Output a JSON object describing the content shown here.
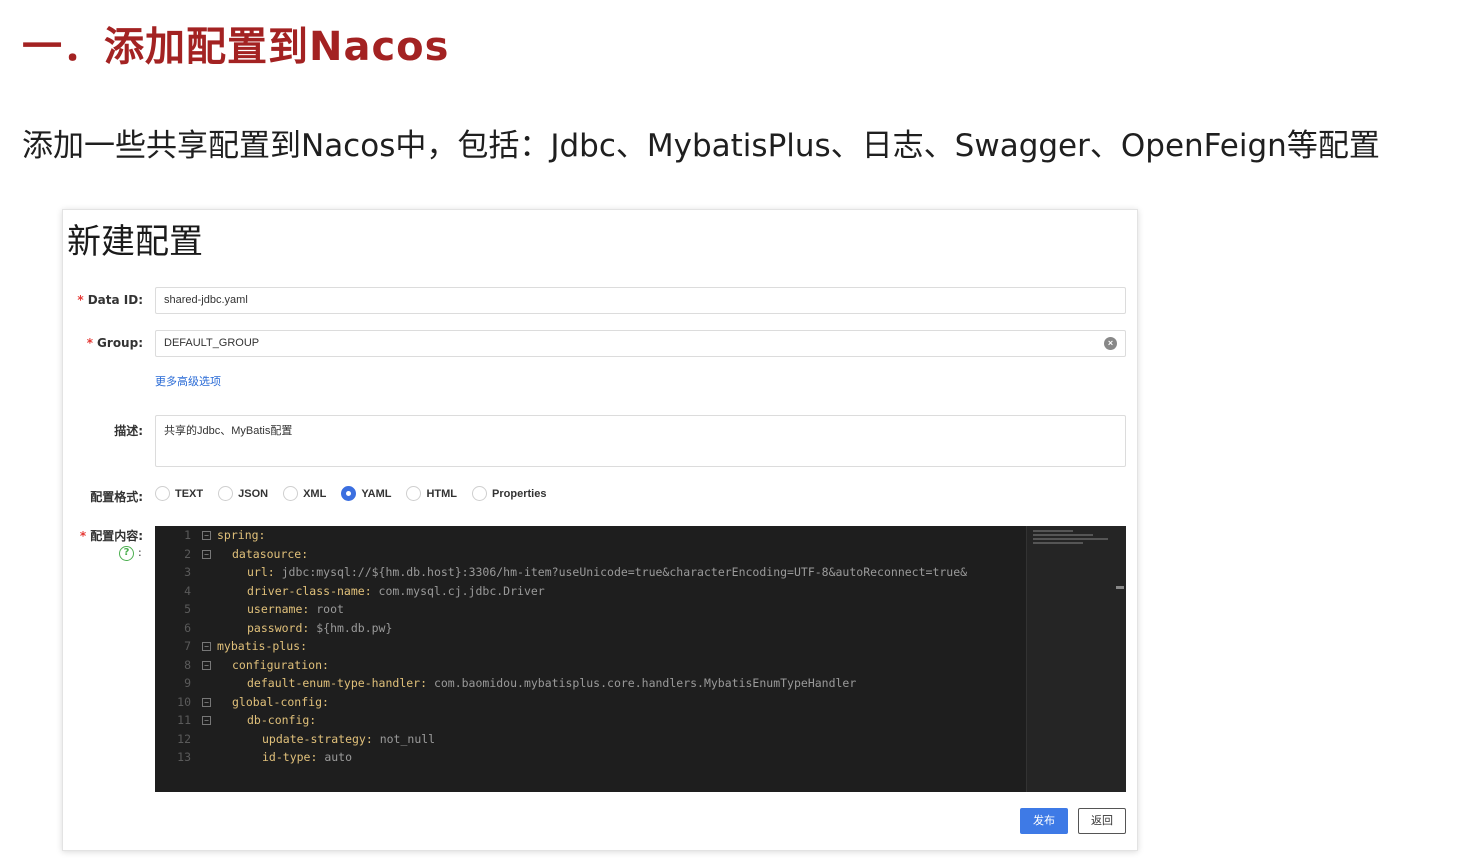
{
  "slide": {
    "title": "一．添加配置到Nacos",
    "description": "添加一些共享配置到Nacos中，包括：Jdbc、MybatisPlus、日志、Swagger、OpenFeign等配置"
  },
  "form": {
    "title": "新建配置",
    "data_id_label": "Data ID:",
    "data_id_value": "shared-jdbc.yaml",
    "group_label": "Group:",
    "group_value": "DEFAULT_GROUP",
    "advanced_link": "更多高级选项",
    "description_label": "描述:",
    "description_value": "共享的Jdbc、MyBatis配置",
    "format_label": "配置格式:",
    "formats": [
      "TEXT",
      "JSON",
      "XML",
      "YAML",
      "HTML",
      "Properties"
    ],
    "selected_format": "YAML",
    "content_label": "配置内容:",
    "help_colon": ":",
    "publish_label": "发布",
    "back_label": "返回"
  },
  "editor": {
    "lines": [
      {
        "n": "1",
        "fold": true,
        "indent": 0,
        "key": "spring:",
        "val": ""
      },
      {
        "n": "2",
        "fold": true,
        "indent": 1,
        "key": "datasource:",
        "val": ""
      },
      {
        "n": "3",
        "fold": false,
        "indent": 2,
        "key": "url:",
        "val": " jdbc:mysql://${hm.db.host}:3306/hm-item?useUnicode=true&characterEncoding=UTF-8&autoReconnect=true&"
      },
      {
        "n": "4",
        "fold": false,
        "indent": 2,
        "key": "driver-class-name:",
        "val": " com.mysql.cj.jdbc.Driver"
      },
      {
        "n": "5",
        "fold": false,
        "indent": 2,
        "key": "username:",
        "val": " root"
      },
      {
        "n": "6",
        "fold": false,
        "indent": 2,
        "key": "password:",
        "val": " ${hm.db.pw}"
      },
      {
        "n": "7",
        "fold": true,
        "indent": 0,
        "key": "mybatis-plus:",
        "val": ""
      },
      {
        "n": "8",
        "fold": true,
        "indent": 1,
        "key": "configuration:",
        "val": ""
      },
      {
        "n": "9",
        "fold": false,
        "indent": 2,
        "key": "default-enum-type-handler:",
        "val": " com.baomidou.mybatisplus.core.handlers.MybatisEnumTypeHandler"
      },
      {
        "n": "10",
        "fold": true,
        "indent": 1,
        "key": "global-config:",
        "val": ""
      },
      {
        "n": "11",
        "fold": true,
        "indent": 2,
        "key": "db-config:",
        "val": ""
      },
      {
        "n": "12",
        "fold": false,
        "indent": 3,
        "key": "update-strategy:",
        "val": " not_null"
      },
      {
        "n": "13",
        "fold": false,
        "indent": 3,
        "key": "id-type:",
        "val": " auto"
      }
    ]
  }
}
